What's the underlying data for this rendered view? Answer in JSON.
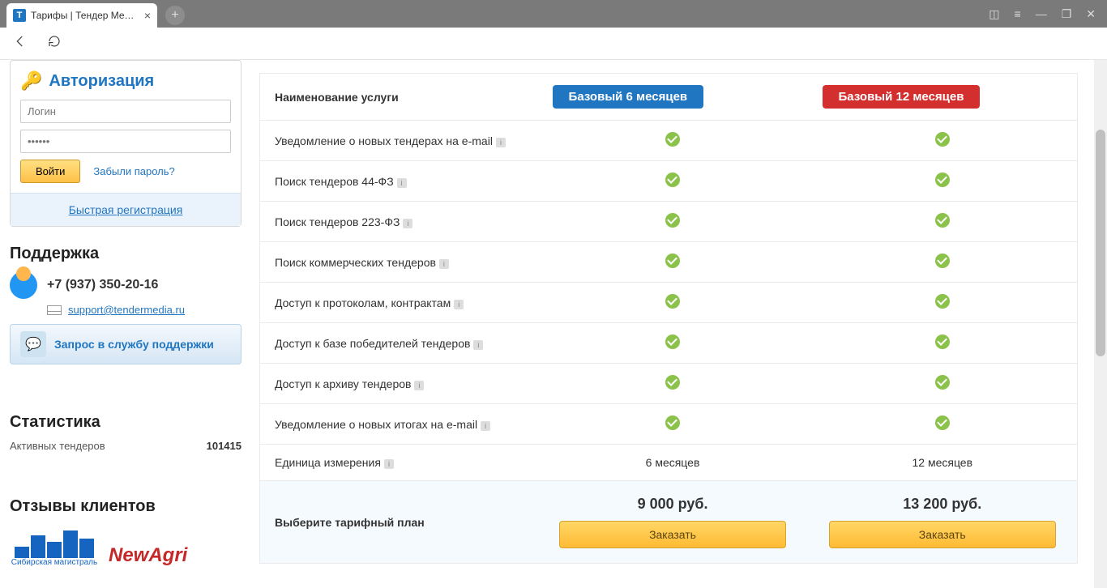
{
  "browser": {
    "tab_title": "Тарифы | Тендер Меди...",
    "favicon_letter": "Т"
  },
  "auth": {
    "title": "Авторизация",
    "login_placeholder": "Логин",
    "password_placeholder": "••••••",
    "login_button": "Войти",
    "forgot": "Забыли пароль?",
    "quick_reg": "Быстрая регистрация"
  },
  "support": {
    "title": "Поддержка",
    "phone": "+7 (937) 350-20-16",
    "email": "support@tendermedia.ru",
    "request_button": "Запрос в службу поддержки"
  },
  "stats": {
    "title": "Статистика",
    "label": "Активных тендеров",
    "value": "101415"
  },
  "reviews": {
    "title": "Отзывы клиентов",
    "logo1": "Сибирская магистраль",
    "logo2": "NewAgri"
  },
  "pricing": {
    "feature_header": "Наименование услуги",
    "plan1_label": "Базовый 6 месяцев",
    "plan2_label": "Базовый 12 месяцев",
    "features": [
      "Уведомление о новых тендерах на e-mail",
      "Поиск тендеров 44-ФЗ",
      "Поиск тендеров 223-ФЗ",
      "Поиск коммерческих тендеров",
      "Доступ к протоколам, контрактам",
      "Доступ к базе победителей тендеров",
      "Доступ к архиву тендеров",
      "Уведомление о новых итогах на e-mail"
    ],
    "unit_label": "Единица измерения",
    "unit1": "6 месяцев",
    "unit2": "12 месяцев",
    "cta_label": "Выберите тарифный план",
    "price1": "9 000 руб.",
    "price2": "13 200 руб.",
    "order_button": "Заказать"
  }
}
